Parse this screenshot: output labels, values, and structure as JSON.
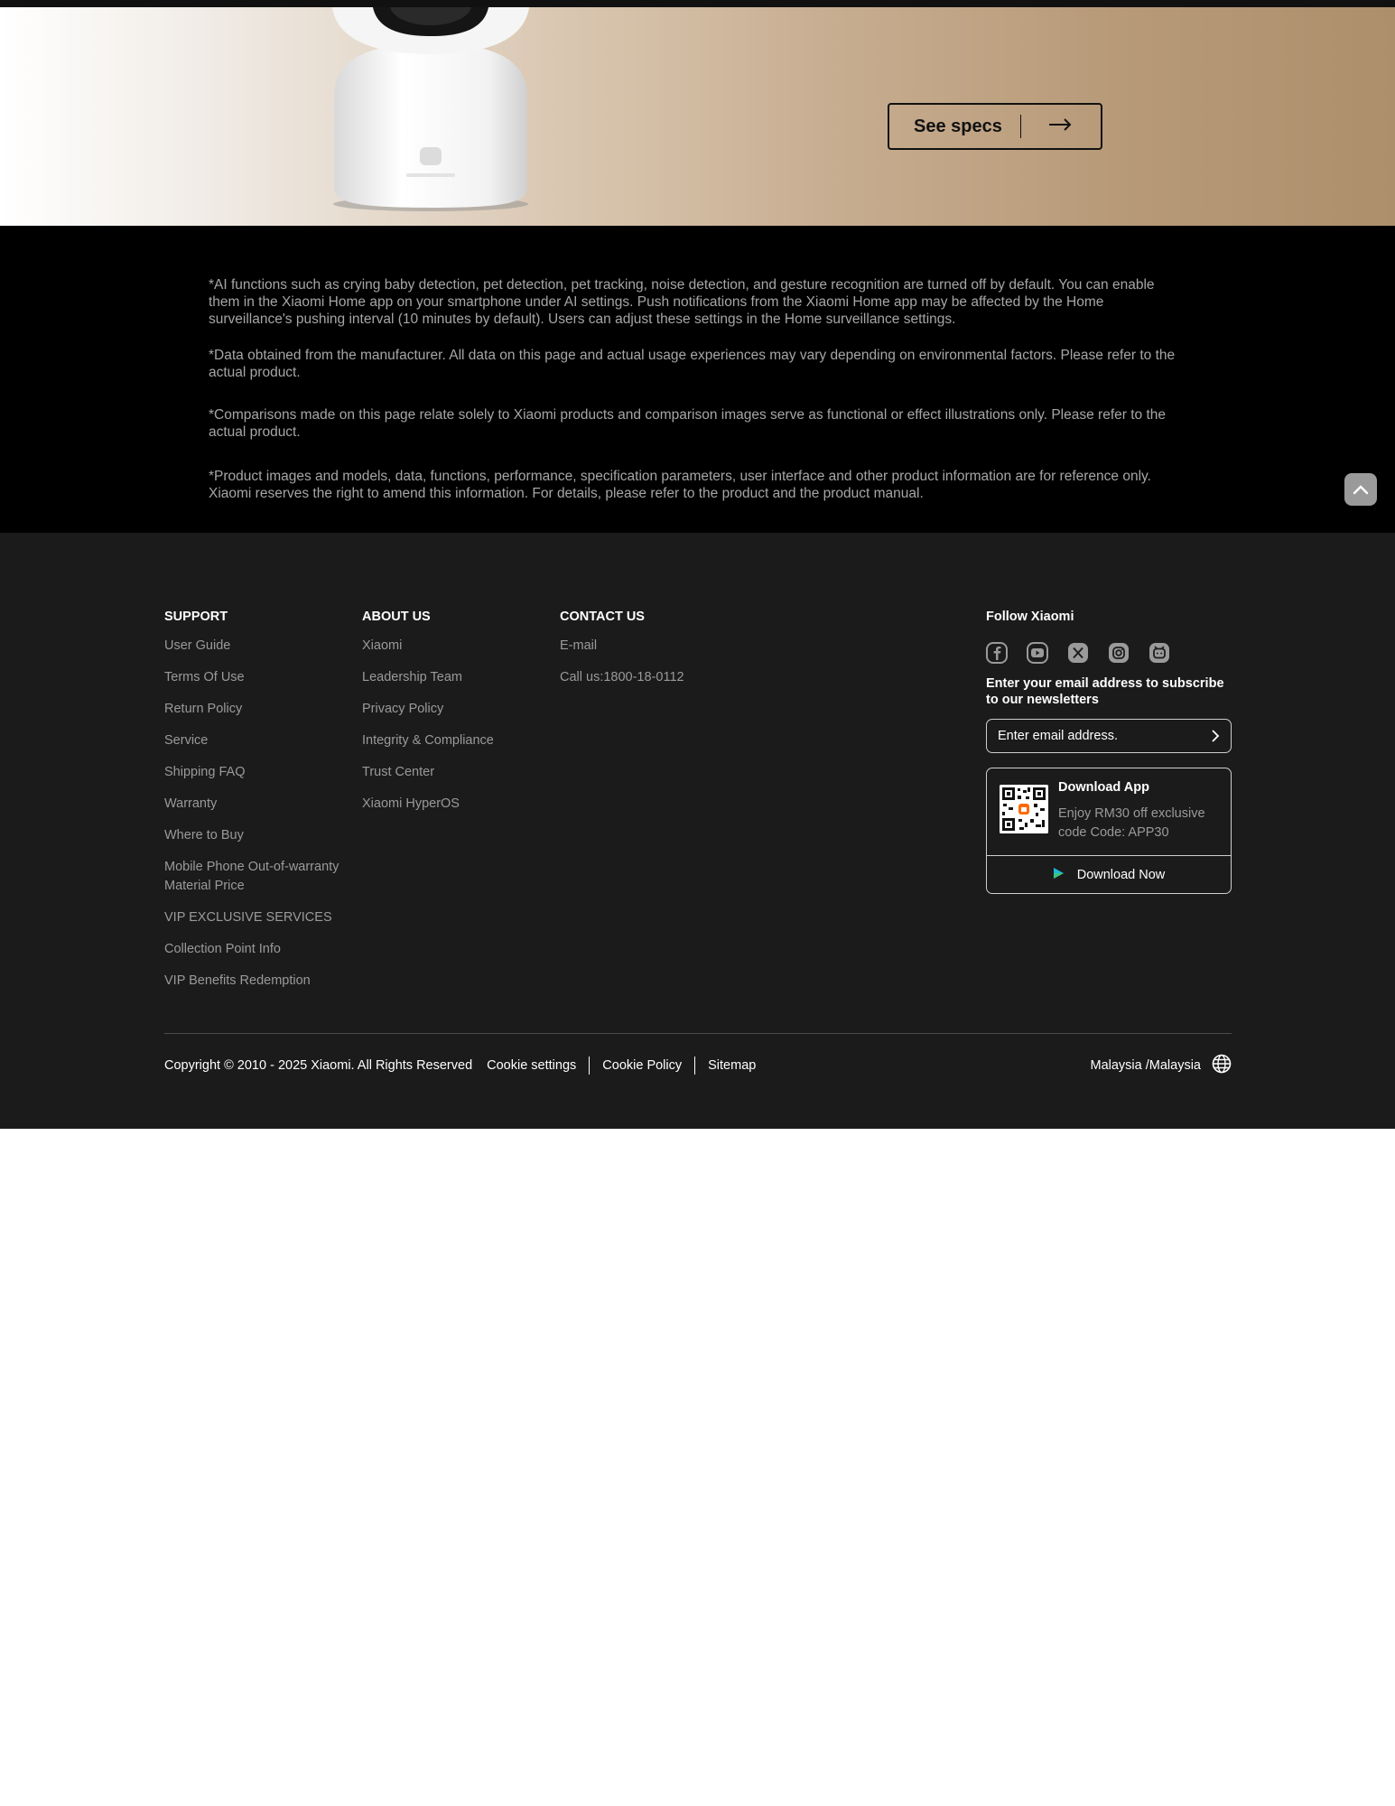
{
  "banner": {
    "see_specs_label": "See specs"
  },
  "disclaimers": [
    "*AI functions such as crying baby detection, pet detection, pet tracking, noise detection, and gesture recognition are turned off by default. You can enable them in the Xiaomi Home app on your smartphone under AI settings. Push notifications from the Xiaomi Home app may be affected by the Home surveillance's pushing interval (10 minutes by default). Users can adjust these settings in the Home surveillance settings.",
    "*Data obtained from the manufacturer. All data on this page and actual usage experiences may vary depending on environmental factors. Please refer to the actual product.",
    "*Comparisons made on this page relate solely to Xiaomi products and comparison images serve as functional or effect illustrations only. Please refer to the actual product.",
    "*Product images and models, data, functions, performance, specification parameters, user interface and other product information are for reference only. Xiaomi reserves the right to amend this information. For details, please refer to the product and the product manual."
  ],
  "footer": {
    "support": {
      "heading": "SUPPORT",
      "links": [
        "User Guide",
        "Terms Of Use",
        "Return Policy",
        "Service",
        "Shipping FAQ",
        "Warranty",
        "Where to Buy",
        "Mobile Phone Out-of-warranty Material Price",
        "VIP EXCLUSIVE SERVICES",
        "Collection Point Info",
        "VIP Benefits Redemption"
      ]
    },
    "about": {
      "heading": "ABOUT US",
      "links": [
        "Xiaomi",
        "Leadership Team",
        "Privacy Policy",
        "Integrity & Compliance",
        "Trust Center",
        "Xiaomi HyperOS"
      ]
    },
    "contact": {
      "heading": "CONTACT US",
      "links": [
        "E-mail",
        "Call us:1800-18-0112"
      ]
    },
    "follow": {
      "heading": "Follow Xiaomi",
      "social_icons": [
        "facebook-icon",
        "youtube-icon",
        "x-icon",
        "instagram-icon",
        "xiaomi-community-icon"
      ],
      "newsletter_label": "Enter your email address to subscribe to our newsletters",
      "email_placeholder": "Enter email address."
    },
    "app": {
      "title": "Download App",
      "description": "Enjoy RM30 off exclusive code Code: APP30",
      "download_label": "Download Now"
    },
    "bottom": {
      "copyright": "Copyright © 2010 - 2025 Xiaomi. All Rights Reserved",
      "links": [
        "Cookie settings",
        "Cookie Policy",
        "Sitemap"
      ],
      "region": "Malaysia /Malaysia"
    }
  },
  "colors": {
    "footer_bg": "#1b1b1b",
    "disclaimer_bg": "#000000",
    "muted_text": "#9a9a9a",
    "banner_tan": "#ad8f6c"
  }
}
